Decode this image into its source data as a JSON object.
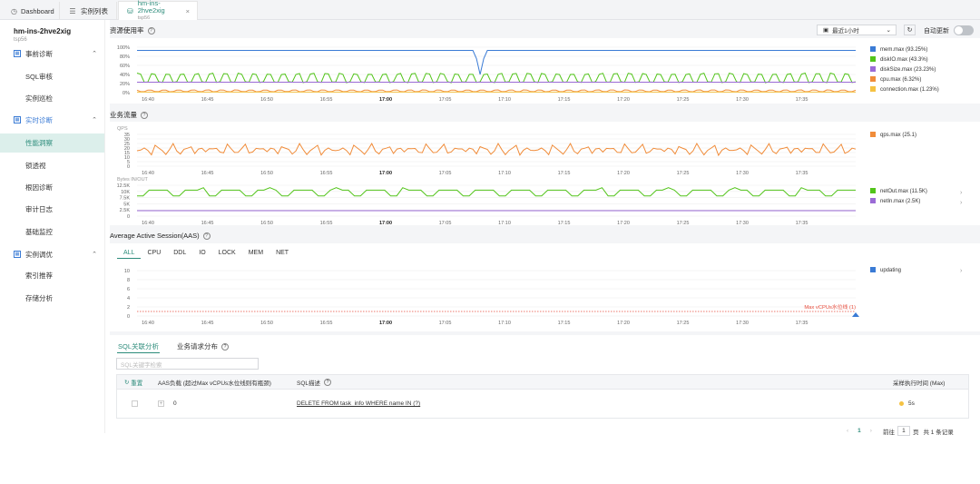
{
  "tabs": [
    {
      "label": "Dashboard"
    },
    {
      "label": "实例列表"
    },
    {
      "label": "hm-ins-2hve2xig",
      "sub": "tsp56"
    }
  ],
  "sidebar": {
    "title": "hm-ins-2hve2xig",
    "subtitle": "tsp56",
    "groups": [
      {
        "label": "事前诊断"
      },
      {
        "label": "实时诊断"
      },
      {
        "label": "实例调优"
      }
    ],
    "items": [
      "SQL审核",
      "实例巡检",
      "性能洞察",
      "锁透视",
      "根因诊断",
      "审计日志",
      "基础监控",
      "索引推荐",
      "存储分析"
    ]
  },
  "header": {
    "section1": "资源使用率",
    "range": "最近1小时",
    "auto_refresh": "自动更新"
  },
  "section2": "业务流量",
  "section3": "Average Active Session(AAS)",
  "x_ticks": [
    "16:40",
    "16:45",
    "16:50",
    "16:55",
    "17:00",
    "17:05",
    "17:10",
    "17:15",
    "17:20",
    "17:25",
    "17:30",
    "17:35"
  ],
  "resource_chart": {
    "yticks": [
      "100%",
      "80%",
      "60%",
      "40%",
      "20%",
      "0%"
    ],
    "legend": [
      {
        "name": "mem.max (93.25%)",
        "color": "#3a7bd5"
      },
      {
        "name": "diskIO.max (43.3%)",
        "color": "#52c41a"
      },
      {
        "name": "diskSize.max (23.23%)",
        "color": "#9b6bd6"
      },
      {
        "name": "cpu.max (6.32%)",
        "color": "#f08c3a"
      },
      {
        "name": "connection.max (1.23%)",
        "color": "#f5c242"
      }
    ]
  },
  "qps_chart": {
    "unit": "QPS",
    "yticks": [
      "35",
      "30",
      "25",
      "20",
      "15",
      "10",
      "5",
      "0"
    ],
    "legend": [
      {
        "name": "qps.max (25.1)",
        "color": "#f08c3a"
      }
    ]
  },
  "net_chart": {
    "unit": "Bytes IN/OUT",
    "yticks": [
      "12.5K",
      "10K",
      "7.5K",
      "5K",
      "2.5K",
      "0"
    ],
    "legend": [
      {
        "name": "netOut.max (11.5K)",
        "color": "#52c41a"
      },
      {
        "name": "netIn.max (2.5K)",
        "color": "#9b6bd6"
      }
    ]
  },
  "aas_chart": {
    "tabs": [
      "ALL",
      "CPU",
      "DDL",
      "IO",
      "LOCK",
      "MEM",
      "NET"
    ],
    "yticks": [
      "10",
      "8",
      "6",
      "4",
      "2",
      "0"
    ],
    "legend": [
      {
        "name": "updating",
        "color": "#3a7bd5"
      }
    ],
    "threshold_label": "Max vCPUs水位线 (1)"
  },
  "chart_data": [
    {
      "type": "line",
      "title": "资源使用率",
      "ylim": [
        0,
        100
      ],
      "series": [
        {
          "name": "mem.max",
          "values": [
            93,
            93,
            93,
            93,
            93,
            93,
            93,
            93,
            93,
            93,
            93,
            93,
            93,
            93,
            93,
            93,
            93,
            93,
            93,
            93,
            93,
            93,
            93,
            93,
            93,
            93,
            93,
            93,
            93,
            93,
            93,
            93,
            93,
            93,
            93,
            93,
            93,
            93,
            93,
            93,
            93,
            93,
            93,
            93,
            93,
            93,
            93,
            93,
            93,
            93,
            93,
            93,
            93,
            93,
            93,
            93,
            93,
            93,
            93,
            93,
            93,
            93,
            93,
            93,
            93,
            93,
            93,
            93,
            93,
            93,
            93,
            93,
            93,
            93,
            93,
            93,
            93,
            93,
            93,
            93,
            93,
            93,
            93,
            93,
            93,
            93,
            93,
            93,
            93,
            93,
            93,
            93,
            93,
            93,
            93,
            93,
            93,
            93,
            93,
            93,
            93,
            93,
            93,
            93,
            93,
            93,
            93,
            93,
            93,
            93,
            93,
            93,
            93,
            93,
            93,
            93,
            93,
            93,
            93,
            93,
            93,
            93,
            93,
            93,
            93,
            93,
            93,
            93,
            93,
            93,
            93,
            93,
            93,
            93,
            93,
            93,
            93,
            93,
            93,
            93,
            93,
            93,
            93,
            93,
            93,
            93,
            93,
            93,
            93,
            93,
            93,
            93,
            93,
            93,
            93,
            93,
            93,
            93,
            93,
            93,
            93,
            93,
            93,
            93,
            93,
            93,
            93,
            93,
            93,
            93,
            93,
            93,
            93,
            93,
            93,
            93,
            93,
            93,
            93,
            93,
            93,
            93,
            93,
            93,
            93,
            93,
            93,
            93,
            93,
            93,
            93,
            93,
            93,
            93,
            93,
            93,
            93,
            93,
            93,
            93
          ]
        },
        {
          "name": "diskIO.max",
          "base": 22,
          "peak": 43
        },
        {
          "name": "diskSize.max",
          "base": 23,
          "peak": 23
        },
        {
          "name": "cpu.max",
          "base": 2,
          "peak": 6
        },
        {
          "name": "connection.max",
          "base": 1,
          "peak": 1
        }
      ]
    },
    {
      "type": "line",
      "title": "业务流量",
      "ylim": [
        0,
        35
      ],
      "series": [
        {
          "name": "qps.max",
          "base": 12,
          "peak": 25
        }
      ]
    },
    {
      "type": "line",
      "ylim": [
        0,
        12500
      ],
      "series": [
        {
          "name": "netOut.max",
          "base": 8000,
          "peak": 11500
        },
        {
          "name": "netIn.max",
          "base": 2000,
          "peak": 2500
        }
      ]
    },
    {
      "type": "line",
      "title": "Average Active Session(AAS)",
      "ylim": [
        0,
        10
      ],
      "series": [
        {
          "name": "updating",
          "base": 0,
          "peak": 0
        }
      ],
      "threshold": 1
    }
  ],
  "bottom": {
    "tabs": [
      "SQL关联分析",
      "业务请求分布"
    ],
    "search_placeholder": "SQL关键字检索",
    "columns": [
      "重置",
      "AAS负载 (超过Max vCPUs水位线则有瓶颈)",
      "SQL描述",
      "采样执行时间 (Max)"
    ],
    "rows": [
      {
        "aas": "0",
        "sql": "DELETE FROM task_info WHERE name IN (?)",
        "time": "5s"
      }
    ]
  },
  "pager": {
    "page": "1",
    "goto_label": "前往",
    "goto_value": "1",
    "page_suffix": "页",
    "total": "共 1 条记录"
  }
}
